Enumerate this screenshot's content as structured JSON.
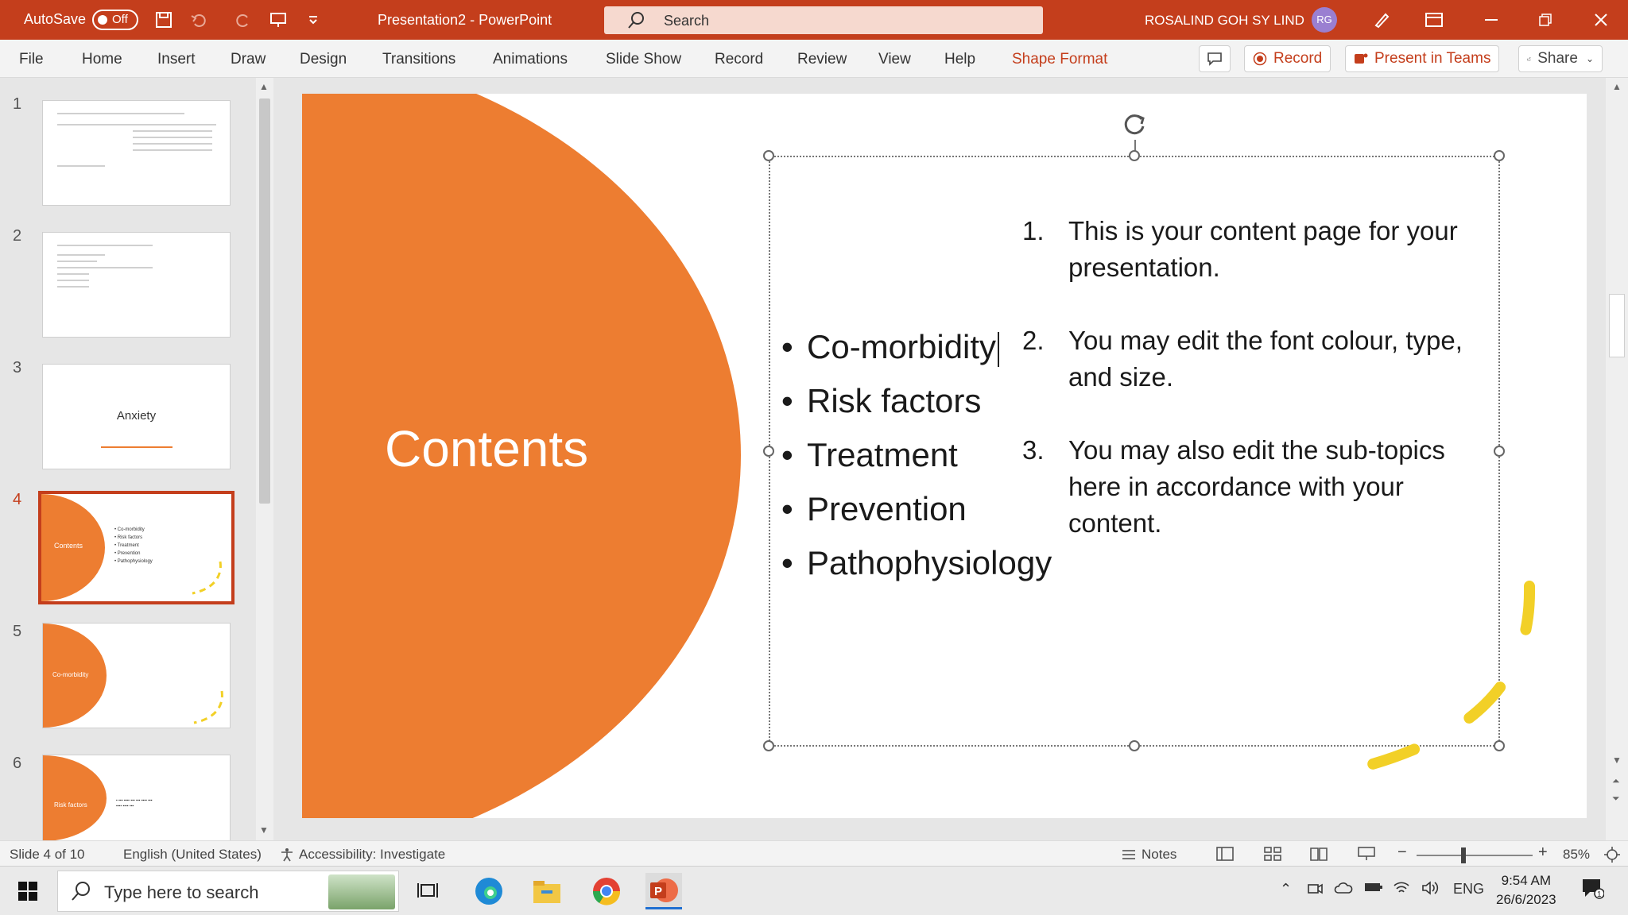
{
  "titlebar": {
    "autosave_label": "AutoSave",
    "autosave_state": "Off",
    "document_title": "Presentation2 - PowerPoint",
    "search_placeholder": "Search",
    "user_name": "ROSALIND GOH SY LIND",
    "user_initials": "RG",
    "accent_color": "#c43e1c"
  },
  "ribbon": {
    "tabs": [
      "File",
      "Home",
      "Insert",
      "Draw",
      "Design",
      "Transitions",
      "Animations",
      "Slide Show",
      "Record",
      "Review",
      "View",
      "Help",
      "Shape Format"
    ],
    "record_label": "Record",
    "present_label": "Present in Teams",
    "share_label": "Share"
  },
  "thumbnails": {
    "numbers": [
      "1",
      "2",
      "3",
      "4",
      "5",
      "6"
    ],
    "slide3_title": "Anxiety",
    "slide4_title": "Contents",
    "slide4_bullets": [
      "• Co-morbidity",
      "• Risk factors",
      "• Treatment",
      "• Prevention",
      "• Pathophysiology"
    ],
    "slide5_title": "Co-morbidity",
    "slide6_title": "Risk factors"
  },
  "slide": {
    "title": "Contents",
    "bullets": [
      "Co-morbidity",
      "Risk factors",
      "Treatment",
      "Prevention",
      "Pathophysiology"
    ],
    "numbered": [
      {
        "n": "1.",
        "text": "This is your content page for your presentation."
      },
      {
        "n": "2.",
        "text": "You may edit the font colour, type, and size."
      },
      {
        "n": "3.",
        "text": "You may also edit the sub-topics here in accordance with your content."
      }
    ],
    "shape_color": "#ed7d31"
  },
  "statusbar": {
    "slide_info": "Slide 4 of 10",
    "language": "English (United States)",
    "accessibility": "Accessibility: Investigate",
    "notes_label": "Notes",
    "zoom": "85%"
  },
  "taskbar": {
    "search_placeholder": "Type here to search",
    "language": "ENG",
    "time": "9:54 AM",
    "date": "26/6/2023"
  }
}
